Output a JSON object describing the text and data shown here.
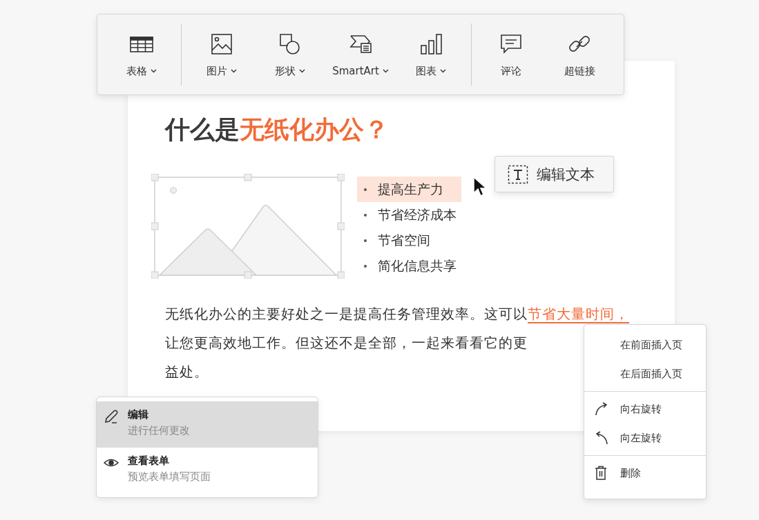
{
  "toolbar": {
    "groups": [
      [
        {
          "label": "表格",
          "dropdown": true
        }
      ],
      [
        {
          "label": "图片",
          "dropdown": true
        },
        {
          "label": "形状",
          "dropdown": true
        },
        {
          "label": "SmartArt",
          "dropdown": true
        },
        {
          "label": "图表",
          "dropdown": true
        }
      ],
      [
        {
          "label": "评论",
          "dropdown": false
        },
        {
          "label": "超链接",
          "dropdown": false
        }
      ]
    ]
  },
  "document": {
    "title": [
      {
        "text": "什么是",
        "accent": false
      },
      {
        "text": "无纸化办公？",
        "accent": true
      }
    ],
    "bullets": [
      {
        "text": "提高生产力",
        "highlighted": true
      },
      {
        "text": "节省经济成本",
        "highlighted": false
      },
      {
        "text": "节省空间",
        "highlighted": false
      },
      {
        "text": "简化信息共享",
        "highlighted": false
      }
    ],
    "paragraph": {
      "before": "无纸化办公的主要好处之一是提高任务管理效率。这可以",
      "link": "节省大量时间，",
      "after": "让您更高效地工作。但这还不是全部，一起来看看它的更",
      "last_line": "益处。"
    }
  },
  "tooltip": {
    "label": "编辑文本"
  },
  "mode_menu": [
    {
      "title": "编辑",
      "subtitle": "进行任何更改",
      "selected": true
    },
    {
      "title": "查看表单",
      "subtitle": "预览表单填写页面",
      "selected": false
    }
  ],
  "context_menu": [
    [
      "在前面插入页",
      "在后面插入页"
    ],
    [
      "向右旋转",
      "向左旋转"
    ],
    [
      "删除"
    ]
  ]
}
